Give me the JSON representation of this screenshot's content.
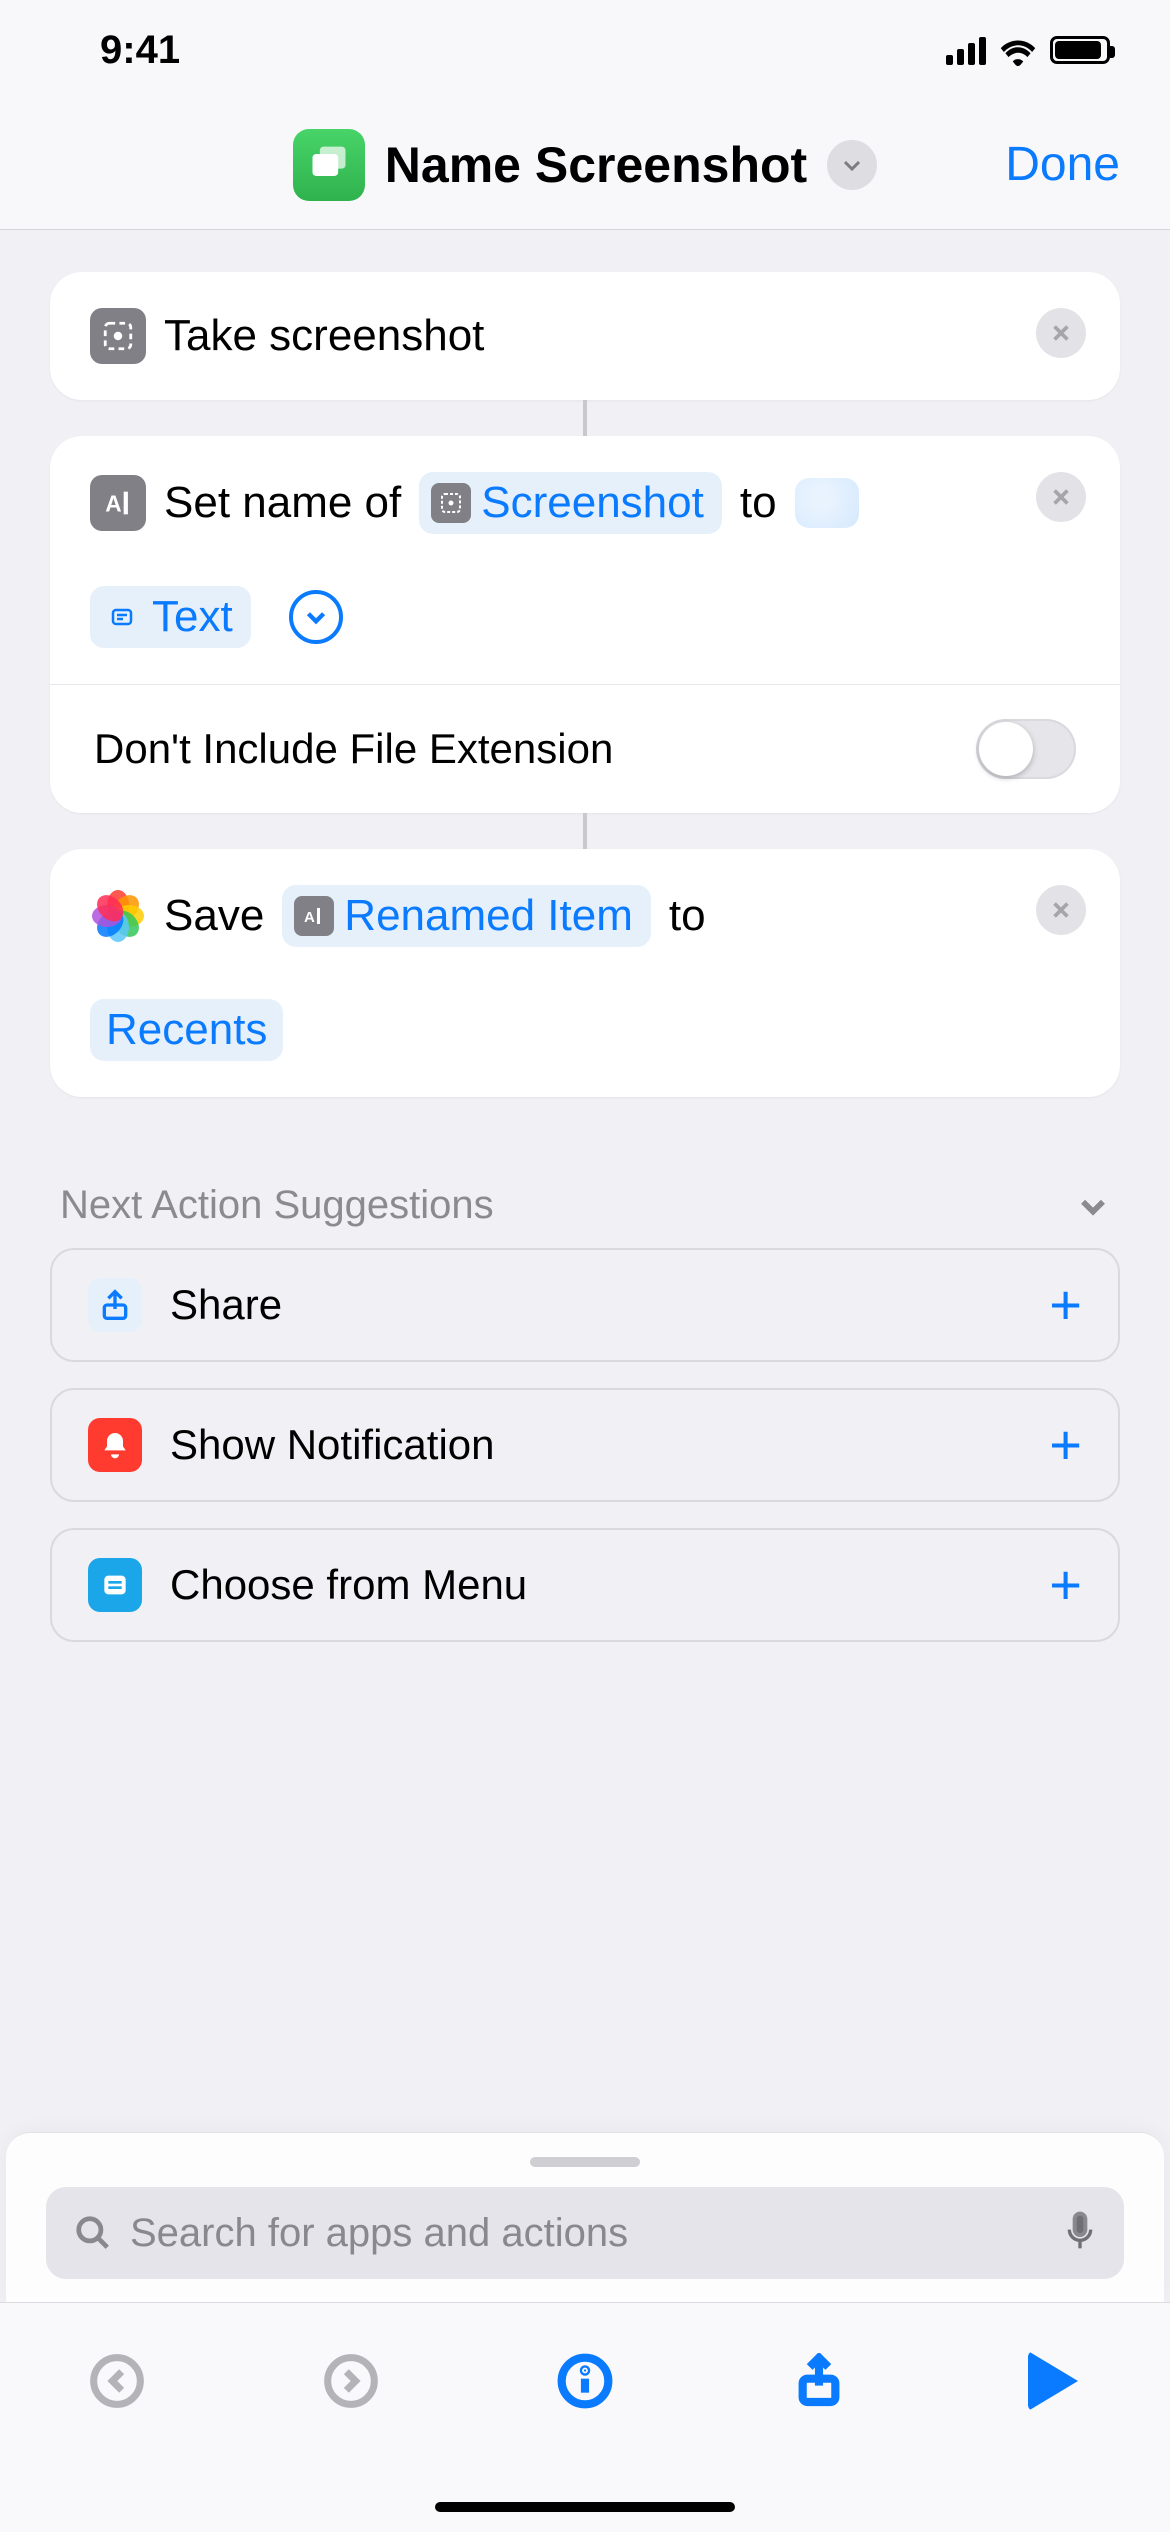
{
  "status": {
    "time": "9:41"
  },
  "header": {
    "title": "Name Screenshot",
    "done": "Done"
  },
  "actions": {
    "a1": {
      "label": "Take screenshot"
    },
    "a2": {
      "prefix": "Set name of",
      "var_label": "Screenshot",
      "to": "to",
      "text_token": "Text",
      "option_label": "Don't Include File Extension"
    },
    "a3": {
      "prefix": "Save",
      "var_label": "Renamed Item",
      "to": "to",
      "dest": "Recents"
    }
  },
  "suggestions": {
    "header": "Next Action Suggestions",
    "items": [
      {
        "label": "Share",
        "icon": "share",
        "bg": "#e6f0fb",
        "fg": "#0a7aff"
      },
      {
        "label": "Show Notification",
        "icon": "bell",
        "bg": "#ff3b30",
        "fg": "#ffffff"
      },
      {
        "label": "Choose from Menu",
        "icon": "menu",
        "bg": "#1aa6e8",
        "fg": "#ffffff"
      }
    ]
  },
  "search": {
    "placeholder": "Search for apps and actions"
  }
}
